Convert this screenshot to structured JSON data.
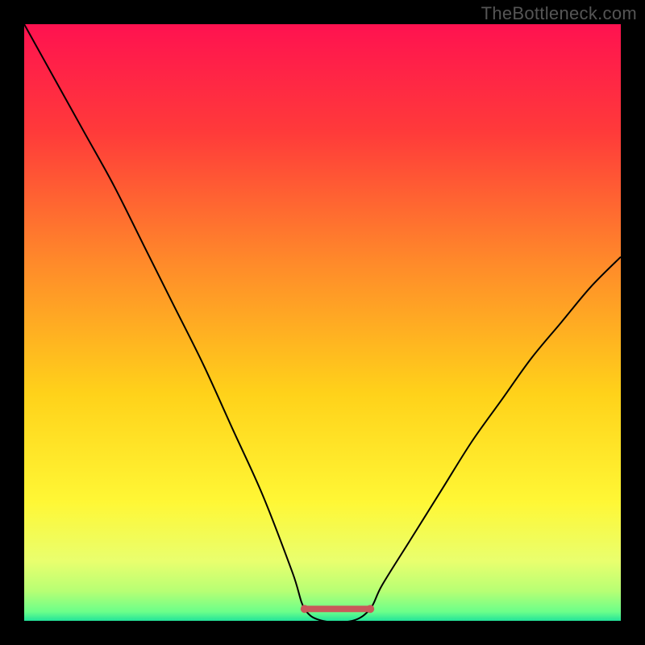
{
  "watermark": "TheBottleneck.com",
  "chart_data": {
    "type": "line",
    "title": "",
    "xlabel": "",
    "ylabel": "",
    "xlim": [
      0,
      100
    ],
    "ylim": [
      0,
      100
    ],
    "x": [
      0,
      5,
      10,
      15,
      20,
      25,
      30,
      35,
      40,
      45,
      47,
      50,
      55,
      58,
      60,
      65,
      70,
      75,
      80,
      85,
      90,
      95,
      100
    ],
    "values": [
      100,
      91,
      82,
      73,
      63,
      53,
      43,
      32,
      21,
      8,
      2,
      0,
      0,
      2,
      6,
      14,
      22,
      30,
      37,
      44,
      50,
      56,
      61
    ],
    "flat_region": {
      "x_start": 47,
      "x_end": 58,
      "y": 2
    },
    "background_gradient": {
      "stops": [
        {
          "pos": 0.0,
          "color": "#ff1250"
        },
        {
          "pos": 0.18,
          "color": "#ff3a3a"
        },
        {
          "pos": 0.4,
          "color": "#ff8a2a"
        },
        {
          "pos": 0.62,
          "color": "#ffd21a"
        },
        {
          "pos": 0.8,
          "color": "#fff735"
        },
        {
          "pos": 0.9,
          "color": "#e9ff6e"
        },
        {
          "pos": 0.95,
          "color": "#b7ff74"
        },
        {
          "pos": 0.985,
          "color": "#6bff8a"
        },
        {
          "pos": 1.0,
          "color": "#22e39a"
        }
      ]
    },
    "styles": {
      "curve_color": "#000000",
      "curve_width": 2,
      "flat_color": "#c85a5a",
      "flat_width": 8
    }
  }
}
